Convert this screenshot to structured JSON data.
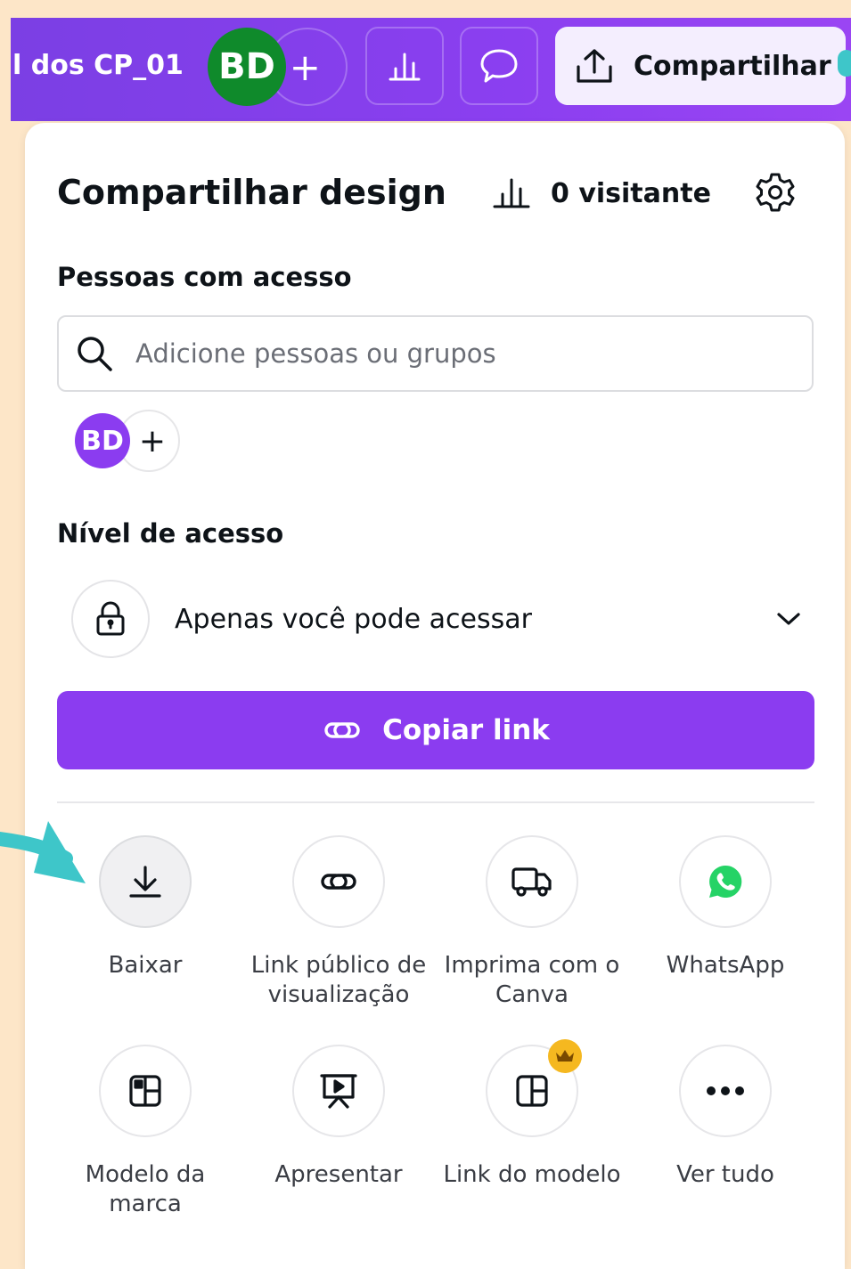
{
  "topbar": {
    "doc_title": "l dos CP_01",
    "avatar_initials": "BD",
    "add_label": "+",
    "share_label": "Compartilhar"
  },
  "panel": {
    "title": "Compartilhar design",
    "visitors": "0 visitante",
    "people_label": "Pessoas com acesso",
    "search_placeholder": "Adicione pessoas ou grupos",
    "member_initials": "BD",
    "member_add": "+",
    "access_label": "Nível de acesso",
    "access_value": "Apenas você pode acessar",
    "copy_link": "Copiar link"
  },
  "options": [
    {
      "label": "Baixar",
      "icon": "download-icon"
    },
    {
      "label": "Link público de visualização",
      "icon": "link-icon"
    },
    {
      "label": "Imprima com o Canva",
      "icon": "truck-icon"
    },
    {
      "label": "WhatsApp",
      "icon": "whatsapp-icon"
    },
    {
      "label": "Modelo da marca",
      "icon": "brand-template-icon"
    },
    {
      "label": "Apresentar",
      "icon": "present-icon"
    },
    {
      "label": "Link do modelo",
      "icon": "template-icon"
    },
    {
      "label": "Ver tudo",
      "icon": "more-icon"
    }
  ],
  "colors": {
    "accent": "#8b3cf0",
    "topbar": "#7b3fe4",
    "avatar_green": "#0f8a2b",
    "crown": "#f5b820",
    "arrow": "#3ec6c9",
    "whatsapp": "#25d366"
  }
}
